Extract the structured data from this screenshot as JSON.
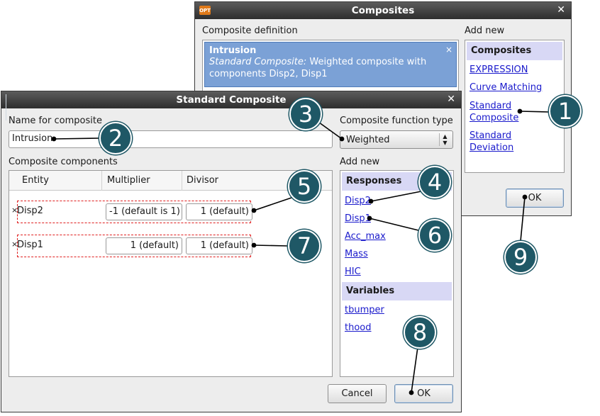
{
  "composites_window": {
    "title": "Composites",
    "definition_label": "Composite definition",
    "add_new_label": "Add new",
    "definition": {
      "name": "Intrusion",
      "type_label": "Standard Composite:",
      "description": "Weighted composite with components Disp2, Disp1"
    },
    "add_new": {
      "section": "Composites",
      "links": [
        "EXPRESSION",
        "Curve Matching",
        "Standard Composite",
        "Standard Deviation"
      ]
    },
    "ok_label": "OK"
  },
  "standard_composite_window": {
    "title": "Standard Composite",
    "name_label": "Name for composite",
    "name_value": "Intrusion",
    "function_type_label": "Composite function type",
    "function_type_value": "Weighted",
    "components_label": "Composite components",
    "columns": [
      "Entity",
      "Multiplier",
      "Divisor"
    ],
    "rows": [
      {
        "entity": "Disp2",
        "multiplier": "-1 (default is 1)",
        "divisor": "1 (default)"
      },
      {
        "entity": "Disp1",
        "multiplier": "1 (default)",
        "divisor": "1 (default)"
      }
    ],
    "add_new_label": "Add new",
    "responses_section": "Responses",
    "responses": [
      "Disp2",
      "Disp1",
      "Acc_max",
      "Mass",
      "HIC"
    ],
    "variables_section": "Variables",
    "variables": [
      "tbumper",
      "thood"
    ],
    "cancel_label": "Cancel",
    "ok_label": "OK"
  },
  "callouts": [
    "1",
    "2",
    "3",
    "4",
    "5",
    "6",
    "7",
    "8",
    "9"
  ],
  "colors": {
    "callout_fill": "#1f5866",
    "selection": "#7ba1d6",
    "section_bg": "#d8d8f5",
    "row_highlight": "#e02020"
  }
}
